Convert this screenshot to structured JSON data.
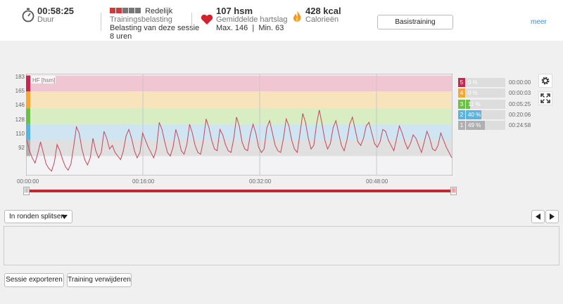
{
  "summary": {
    "duration_value": "00:58:25",
    "duration_label": "Duur",
    "load_label": "Redelijk",
    "load_title": "Trainingsbelasting",
    "load_line1": "Belasting van deze sessie",
    "load_line2": "8 uren",
    "hr_value": "107 hsm",
    "hr_label": "Gemiddelde hartslag",
    "hr_range": "Max. 146  |  Min. 63",
    "cal_value": "428 kcal",
    "cal_label": "Calorieën",
    "type_button": "Basistraining",
    "more_link": "meer"
  },
  "chart_data": {
    "type": "line",
    "ylabel": "HF [hsm]",
    "y_ticks": [
      183,
      165,
      146,
      128,
      110,
      92
    ],
    "x_ticks": [
      "00:00:00",
      "00:16:00",
      "00:32:00",
      "00:48:00"
    ],
    "x_range_minutes": [
      0,
      58.4
    ],
    "y_range": [
      70,
      185
    ],
    "zone_bounds": [
      92,
      110,
      128,
      146,
      165,
      183
    ],
    "zone_colors": [
      "#e0e0e0",
      "#cfe6f2",
      "#d9edc2",
      "#f7e4bd",
      "#f0c6d3"
    ],
    "series": [
      {
        "color": "#c4465c",
        "values": [
          110,
          98,
          90,
          84,
          95,
          108,
          96,
          83,
          78,
          75,
          85,
          105,
          98,
          88,
          80,
          76,
          83,
          103,
          125,
          118,
          100,
          88,
          82,
          90,
          112,
          98,
          90,
          96,
          120,
          112,
          100,
          104,
          96,
          92,
          88,
          98,
          115,
          122,
          112,
          98,
          90,
          96,
          118,
          110,
          102,
          96,
          90,
          100,
          130,
          122,
          108,
          96,
          92,
          102,
          122,
          112,
          98,
          94,
          105,
          128,
          118,
          104,
          96,
          94,
          110,
          134,
          124,
          110,
          100,
          98,
          122,
          116,
          105,
          98,
          96,
          112,
          136,
          126,
          108,
          100,
          98,
          116,
          128,
          118,
          102,
          96,
          100,
          124,
          132,
          118,
          104,
          98,
          96,
          112,
          134,
          126,
          110,
          100,
          96,
          118,
          140,
          130,
          112,
          100,
          104,
          128,
          144,
          128,
          110,
          100,
          106,
          124,
          132,
          118,
          104,
          98,
          110,
          128,
          136,
          122,
          108,
          104,
          112,
          126,
          130,
          118,
          106,
          102,
          108,
          122,
          120,
          110,
          104,
          98,
          112,
          126,
          118,
          108,
          100,
          106,
          116,
          112,
          104,
          96,
          108,
          120,
          112,
          100,
          98,
          104,
          118,
          110,
          102,
          96,
          90
        ]
      }
    ]
  },
  "zones": [
    {
      "num": "5",
      "pct": "0 %",
      "time": "00:00:00",
      "fraction": 0.0,
      "color": "#c4284f"
    },
    {
      "num": "4",
      "pct": "0 %",
      "time": "00:00:03",
      "fraction": 0.0,
      "color": "#f2a833"
    },
    {
      "num": "3",
      "pct": "11 %",
      "time": "00:05:25",
      "fraction": 0.11,
      "color": "#6cc04a"
    },
    {
      "num": "2",
      "pct": "40 %",
      "time": "00:20:06",
      "fraction": 0.4,
      "color": "#59b5e0"
    },
    {
      "num": "1",
      "pct": "49 %",
      "time": "00:24:58",
      "fraction": 0.49,
      "color": "#b0b0b0"
    }
  ],
  "controls": {
    "laps_dropdown": "In ronden splitsen",
    "export_button": "Sessie exporteren",
    "delete_button": "Training verwijderen"
  }
}
